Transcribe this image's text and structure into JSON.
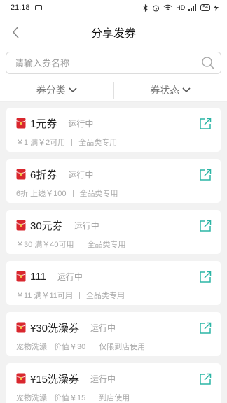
{
  "status_bar": {
    "time": "21:18",
    "network": "HD",
    "signal": "4G",
    "battery": "94"
  },
  "header": {
    "title": "分享发券"
  },
  "search": {
    "placeholder": "请输入券名称",
    "value": ""
  },
  "filters": [
    {
      "label": "券分类"
    },
    {
      "label": "券状态"
    }
  ],
  "colors": {
    "accent": "#2bb5a5",
    "coupon_red": "#d9272e"
  },
  "coupons": [
    {
      "name": "1元券",
      "status": "运行中",
      "details": [
        "￥1 满￥2可用",
        "全品类专用"
      ]
    },
    {
      "name": "6折券",
      "status": "运行中",
      "details": [
        "6折 上线￥100",
        "全品类专用"
      ]
    },
    {
      "name": "30元券",
      "status": "运行中",
      "details": [
        "￥30 满￥40可用",
        "全品类专用"
      ]
    },
    {
      "name": "111",
      "status": "运行中",
      "details": [
        "￥11 满￥11可用",
        "全品类专用"
      ]
    },
    {
      "name": "¥30洗澡券",
      "status": "运行中",
      "details": [
        "宠物洗澡",
        "价值￥30",
        "仅限到店使用"
      ]
    },
    {
      "name": "¥15洗澡券",
      "status": "运行中",
      "details": [
        "宠物洗澡",
        "价值￥15",
        "到店使用"
      ]
    }
  ]
}
